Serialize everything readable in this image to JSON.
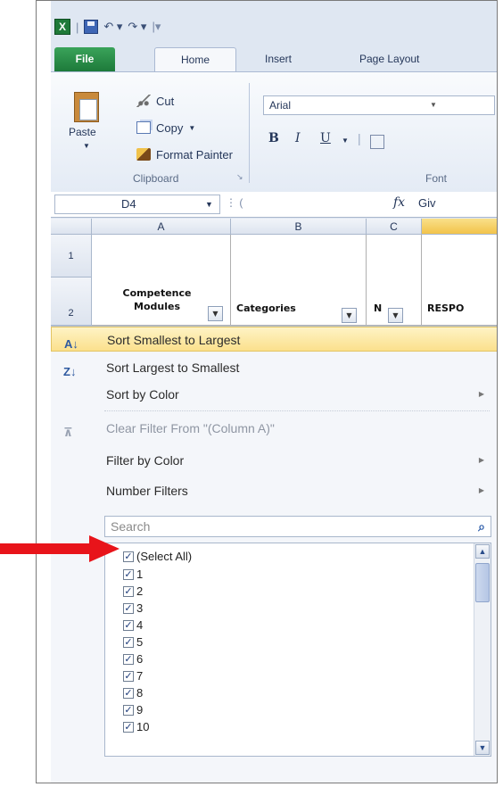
{
  "quick_access": {
    "app_icon": "excel-icon",
    "separator": "|"
  },
  "tabs": {
    "file": "File",
    "home": "Home",
    "insert": "Insert",
    "page_layout": "Page Layout"
  },
  "clipboard": {
    "paste": "Paste",
    "cut": "Cut",
    "copy": "Copy",
    "format_painter": "Format Painter",
    "group_label": "Clipboard"
  },
  "font": {
    "name": "Arial",
    "group_label": "Font",
    "bold": "B",
    "italic": "I",
    "underline": "U"
  },
  "formula_bar": {
    "cell_ref": "D4",
    "fx": "fx",
    "value": "Giv"
  },
  "columns": [
    "A",
    "B",
    "C"
  ],
  "rows": [
    "1",
    "2"
  ],
  "headers": {
    "col_a": "Competence Modules",
    "col_b": "Categories",
    "col_c": "N",
    "col_d": "RESPO"
  },
  "menu": {
    "sort_asc": "Sort Smallest to Largest",
    "sort_desc": "Sort Largest to Smallest",
    "sort_color": "Sort by Color",
    "clear_filter": "Clear Filter From \"(Column A)\"",
    "filter_color": "Filter by Color",
    "number_filters": "Number Filters",
    "search_placeholder": "Search"
  },
  "filter_list": [
    "(Select All)",
    "1",
    "2",
    "3",
    "4",
    "5",
    "6",
    "7",
    "8",
    "9",
    "10"
  ],
  "accent": {
    "highlight": "#fbe08c",
    "arrow": "#e8141a",
    "file_tab": "#1d7a3a"
  }
}
